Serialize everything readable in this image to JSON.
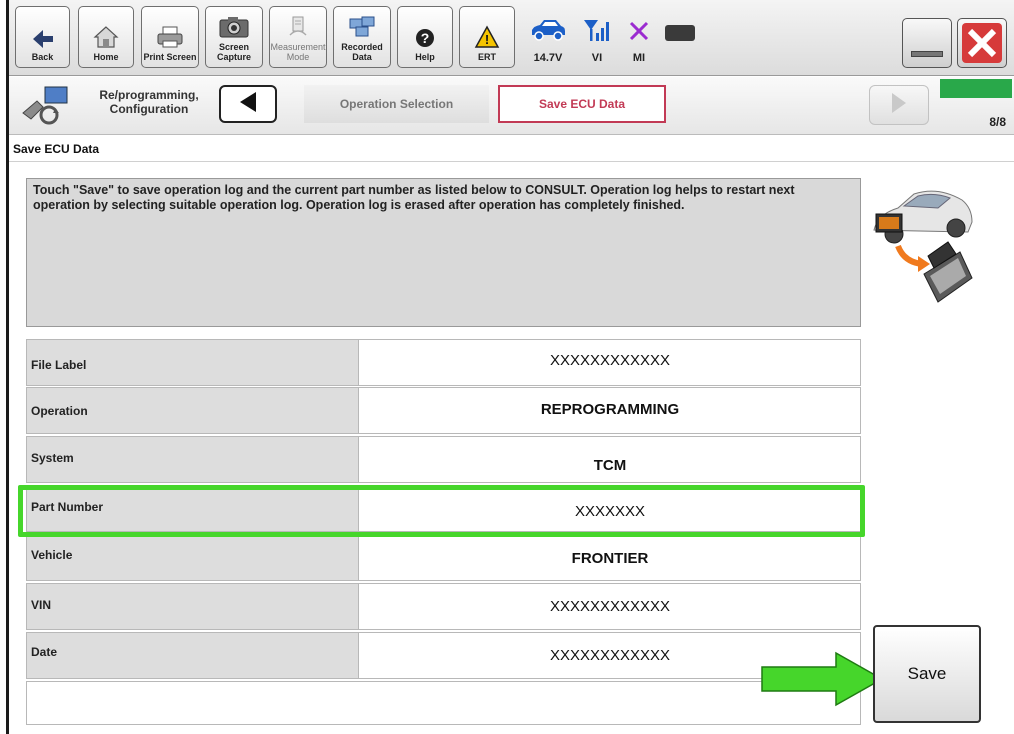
{
  "toolbar": {
    "buttons": [
      {
        "label": "Back",
        "icon": "back-arrow-icon"
      },
      {
        "label": "Home",
        "icon": "home-icon"
      },
      {
        "label": "Print Screen",
        "icon": "printer-icon"
      },
      {
        "label": "Screen Capture",
        "icon": "camera-icon"
      },
      {
        "label": "Measurement Mode",
        "icon": "measurement-icon"
      },
      {
        "label": "Recorded Data",
        "icon": "recorded-data-icon"
      },
      {
        "label": "Help",
        "icon": "help-icon"
      },
      {
        "label": "ERT",
        "icon": "warning-icon"
      }
    ],
    "status": {
      "voltage": "14.7V",
      "vi": "VI",
      "mi": "MI"
    },
    "colors": {
      "warning": "#f5c400",
      "status_blue": "#1c5fc7",
      "mi_x": "#9b2bd0",
      "close_red": "#d63a3a"
    }
  },
  "breadcrumb": {
    "section_title": "Re/programming, Configuration",
    "steps": [
      "Operation Selection",
      "Save ECU Data"
    ],
    "progress_label": "8/8",
    "progress_fraction": 1.0,
    "active_color": "#c23a55",
    "progress_color": "#29a84a"
  },
  "page": {
    "title": "Save ECU Data",
    "instruction": "Touch \"Save\" to save operation log and the current part number as listed below to CONSULT. Operation log helps to restart next operation by selecting suitable operation log. Operation log is erased after operation has completely finished."
  },
  "table": {
    "rows": [
      {
        "label": "File Label",
        "value": "XXXXXXXXXXXX"
      },
      {
        "label": "Operation",
        "value": "REPROGRAMMING"
      },
      {
        "label": "System",
        "value": "TCM"
      },
      {
        "label": "Part Number",
        "value": "XXXXXXX"
      },
      {
        "label": "Vehicle",
        "value": "FRONTIER"
      },
      {
        "label": "VIN",
        "value": "XXXXXXXXXXXX"
      },
      {
        "label": "Date",
        "value": "XXXXXXXXXXXX"
      }
    ],
    "highlight_color": "#46d62b"
  },
  "actions": {
    "save_label": "Save",
    "arrow_color": "#46d62b"
  }
}
